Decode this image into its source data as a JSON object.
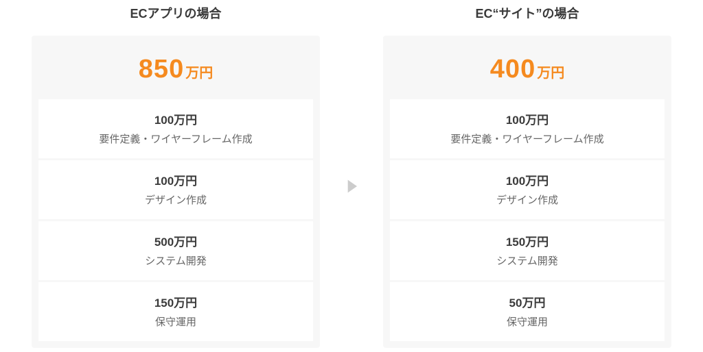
{
  "left": {
    "title": "ECアプリの場合",
    "total_number": "850",
    "total_unit": "万円",
    "items": [
      {
        "price": "100万円",
        "label": "要件定義・ワイヤーフレーム作成"
      },
      {
        "price": "100万円",
        "label": "デザイン作成"
      },
      {
        "price": "500万円",
        "label": "システム開発"
      },
      {
        "price": "150万円",
        "label": "保守運用"
      }
    ]
  },
  "right": {
    "title": "EC“サイト”の場合",
    "total_number": "400",
    "total_unit": "万円",
    "items": [
      {
        "price": "100万円",
        "label": "要件定義・ワイヤーフレーム作成"
      },
      {
        "price": "100万円",
        "label": "デザイン作成"
      },
      {
        "price": "150万円",
        "label": "システム開発"
      },
      {
        "price": "50万円",
        "label": "保守運用"
      }
    ]
  },
  "colors": {
    "accent": "#f58a1f",
    "card_bg": "#f7f7f7",
    "text_primary": "#3a3a3a",
    "text_secondary": "#666666"
  }
}
